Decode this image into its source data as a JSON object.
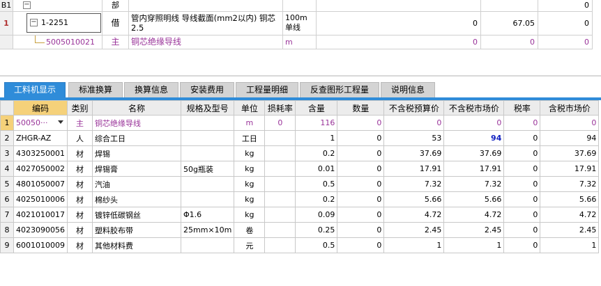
{
  "top_grid": {
    "row_b1": {
      "num": "B1",
      "dept": "部",
      "last_value": "0"
    },
    "row_1": {
      "num": "1",
      "code": "1-2251",
      "type": "借",
      "name": "管内穿照明线 导线截面(mm2以内) 铜芯2.5",
      "unit": "100m单线",
      "v1": "0",
      "v2": "67.05",
      "v3": "0"
    },
    "row_sub": {
      "code": "5005010021",
      "type": "主",
      "name": "铜芯绝缘导线",
      "unit": "m",
      "v1": "0",
      "v2": "0",
      "v3": "0"
    }
  },
  "tabs": [
    {
      "label": "工料机显示",
      "active": true
    },
    {
      "label": "标准换算"
    },
    {
      "label": "换算信息"
    },
    {
      "label": "安装费用"
    },
    {
      "label": "工程量明细"
    },
    {
      "label": "反查图形工程量"
    },
    {
      "label": "说明信息"
    }
  ],
  "table": {
    "headers": [
      "编码",
      "类别",
      "名称",
      "规格及型号",
      "单位",
      "损耗率",
      "含量",
      "数量",
      "不含税预算价",
      "不含税市场价",
      "税率",
      "含税市场价"
    ],
    "rows": [
      {
        "num": "1",
        "code": "50050···",
        "cat": "主",
        "name": "铜芯绝缘导线",
        "spec": "",
        "unit": "m",
        "loss": "0",
        "qty_per": "116",
        "qty": "0",
        "budget": "0",
        "market": "0",
        "tax": "0",
        "market_tax": "0"
      },
      {
        "num": "2",
        "code": "ZHGR-AZ",
        "cat": "人",
        "name": "综合工日",
        "spec": "",
        "unit": "工日",
        "loss": "",
        "qty_per": "1",
        "qty": "0",
        "budget": "53",
        "market": "94",
        "tax": "0",
        "market_tax": "94"
      },
      {
        "num": "3",
        "code": "4303250001",
        "cat": "材",
        "name": "焊锡",
        "spec": "",
        "unit": "kg",
        "loss": "",
        "qty_per": "0.2",
        "qty": "0",
        "budget": "37.69",
        "market": "37.69",
        "tax": "0",
        "market_tax": "37.69"
      },
      {
        "num": "4",
        "code": "4027050002",
        "cat": "材",
        "name": "焊锡膏",
        "spec": "50g瓶装",
        "unit": "kg",
        "loss": "",
        "qty_per": "0.01",
        "qty": "0",
        "budget": "17.91",
        "market": "17.91",
        "tax": "0",
        "market_tax": "17.91"
      },
      {
        "num": "5",
        "code": "4801050007",
        "cat": "材",
        "name": "汽油",
        "spec": "",
        "unit": "kg",
        "loss": "",
        "qty_per": "0.5",
        "qty": "0",
        "budget": "7.32",
        "market": "7.32",
        "tax": "0",
        "market_tax": "7.32"
      },
      {
        "num": "6",
        "code": "4025010006",
        "cat": "材",
        "name": "棉纱头",
        "spec": "",
        "unit": "kg",
        "loss": "",
        "qty_per": "0.2",
        "qty": "0",
        "budget": "5.66",
        "market": "5.66",
        "tax": "0",
        "market_tax": "5.66"
      },
      {
        "num": "7",
        "code": "4021010017",
        "cat": "材",
        "name": "镀锌低碳钢丝",
        "spec": "Φ1.6",
        "unit": "kg",
        "loss": "",
        "qty_per": "0.09",
        "qty": "0",
        "budget": "4.72",
        "market": "4.72",
        "tax": "0",
        "market_tax": "4.72"
      },
      {
        "num": "8",
        "code": "4023090056",
        "cat": "材",
        "name": "塑料胶布带",
        "spec": "25mm×10m",
        "unit": "卷",
        "loss": "",
        "qty_per": "0.25",
        "qty": "0",
        "budget": "2.45",
        "market": "2.45",
        "tax": "0",
        "market_tax": "2.45"
      },
      {
        "num": "9",
        "code": "6001010009",
        "cat": "材",
        "name": "其他材料费",
        "spec": "",
        "unit": "元",
        "loss": "",
        "qty_per": "0.5",
        "qty": "0",
        "budget": "1",
        "market": "1",
        "tax": "0",
        "market_tax": "1"
      }
    ]
  }
}
